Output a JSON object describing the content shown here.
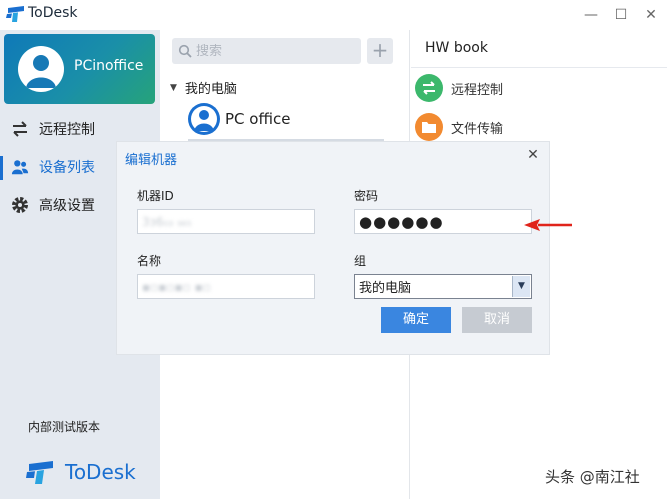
{
  "app": {
    "title": "ToDesk"
  },
  "window_controls": {
    "minimize": "—",
    "maximize": "☐",
    "close": "✕"
  },
  "profile": {
    "name": "PCinoffice"
  },
  "sidebar": {
    "items": [
      {
        "label": "远程控制",
        "icon": "swap-arrows-icon"
      },
      {
        "label": "设备列表",
        "icon": "users-icon",
        "active": true
      },
      {
        "label": "高级设置",
        "icon": "gear-icon"
      }
    ],
    "version_text": "内部测试版本",
    "brand": "ToDesk"
  },
  "device_list": {
    "search_placeholder": "搜索",
    "add_label": "+",
    "group_name": "我的电脑",
    "devices": [
      {
        "name": "PC office"
      }
    ]
  },
  "device_panel": {
    "title": "HW book",
    "actions": [
      {
        "label": "远程控制",
        "icon": "remote-control-icon",
        "color": "#3cb86c"
      },
      {
        "label": "文件传输",
        "icon": "folder-icon",
        "color": "#f28a30"
      }
    ]
  },
  "dialog": {
    "title": "编辑机器",
    "close": "✕",
    "machine_id_label": "机器ID",
    "machine_id_value": "3ɜ6₀₃ ₉₆₅",
    "password_label": "密码",
    "password_value": "●●●●●●",
    "name_label": "名称",
    "name_value": "▪▫▪▫▪▫ ▪▫",
    "group_label": "组",
    "group_value": "我的电脑",
    "ok_label": "确定",
    "cancel_label": "取消"
  },
  "watermark": "头条 @南江社",
  "colors": {
    "accent": "#1a6fd0",
    "annotation": "#e0241b"
  }
}
